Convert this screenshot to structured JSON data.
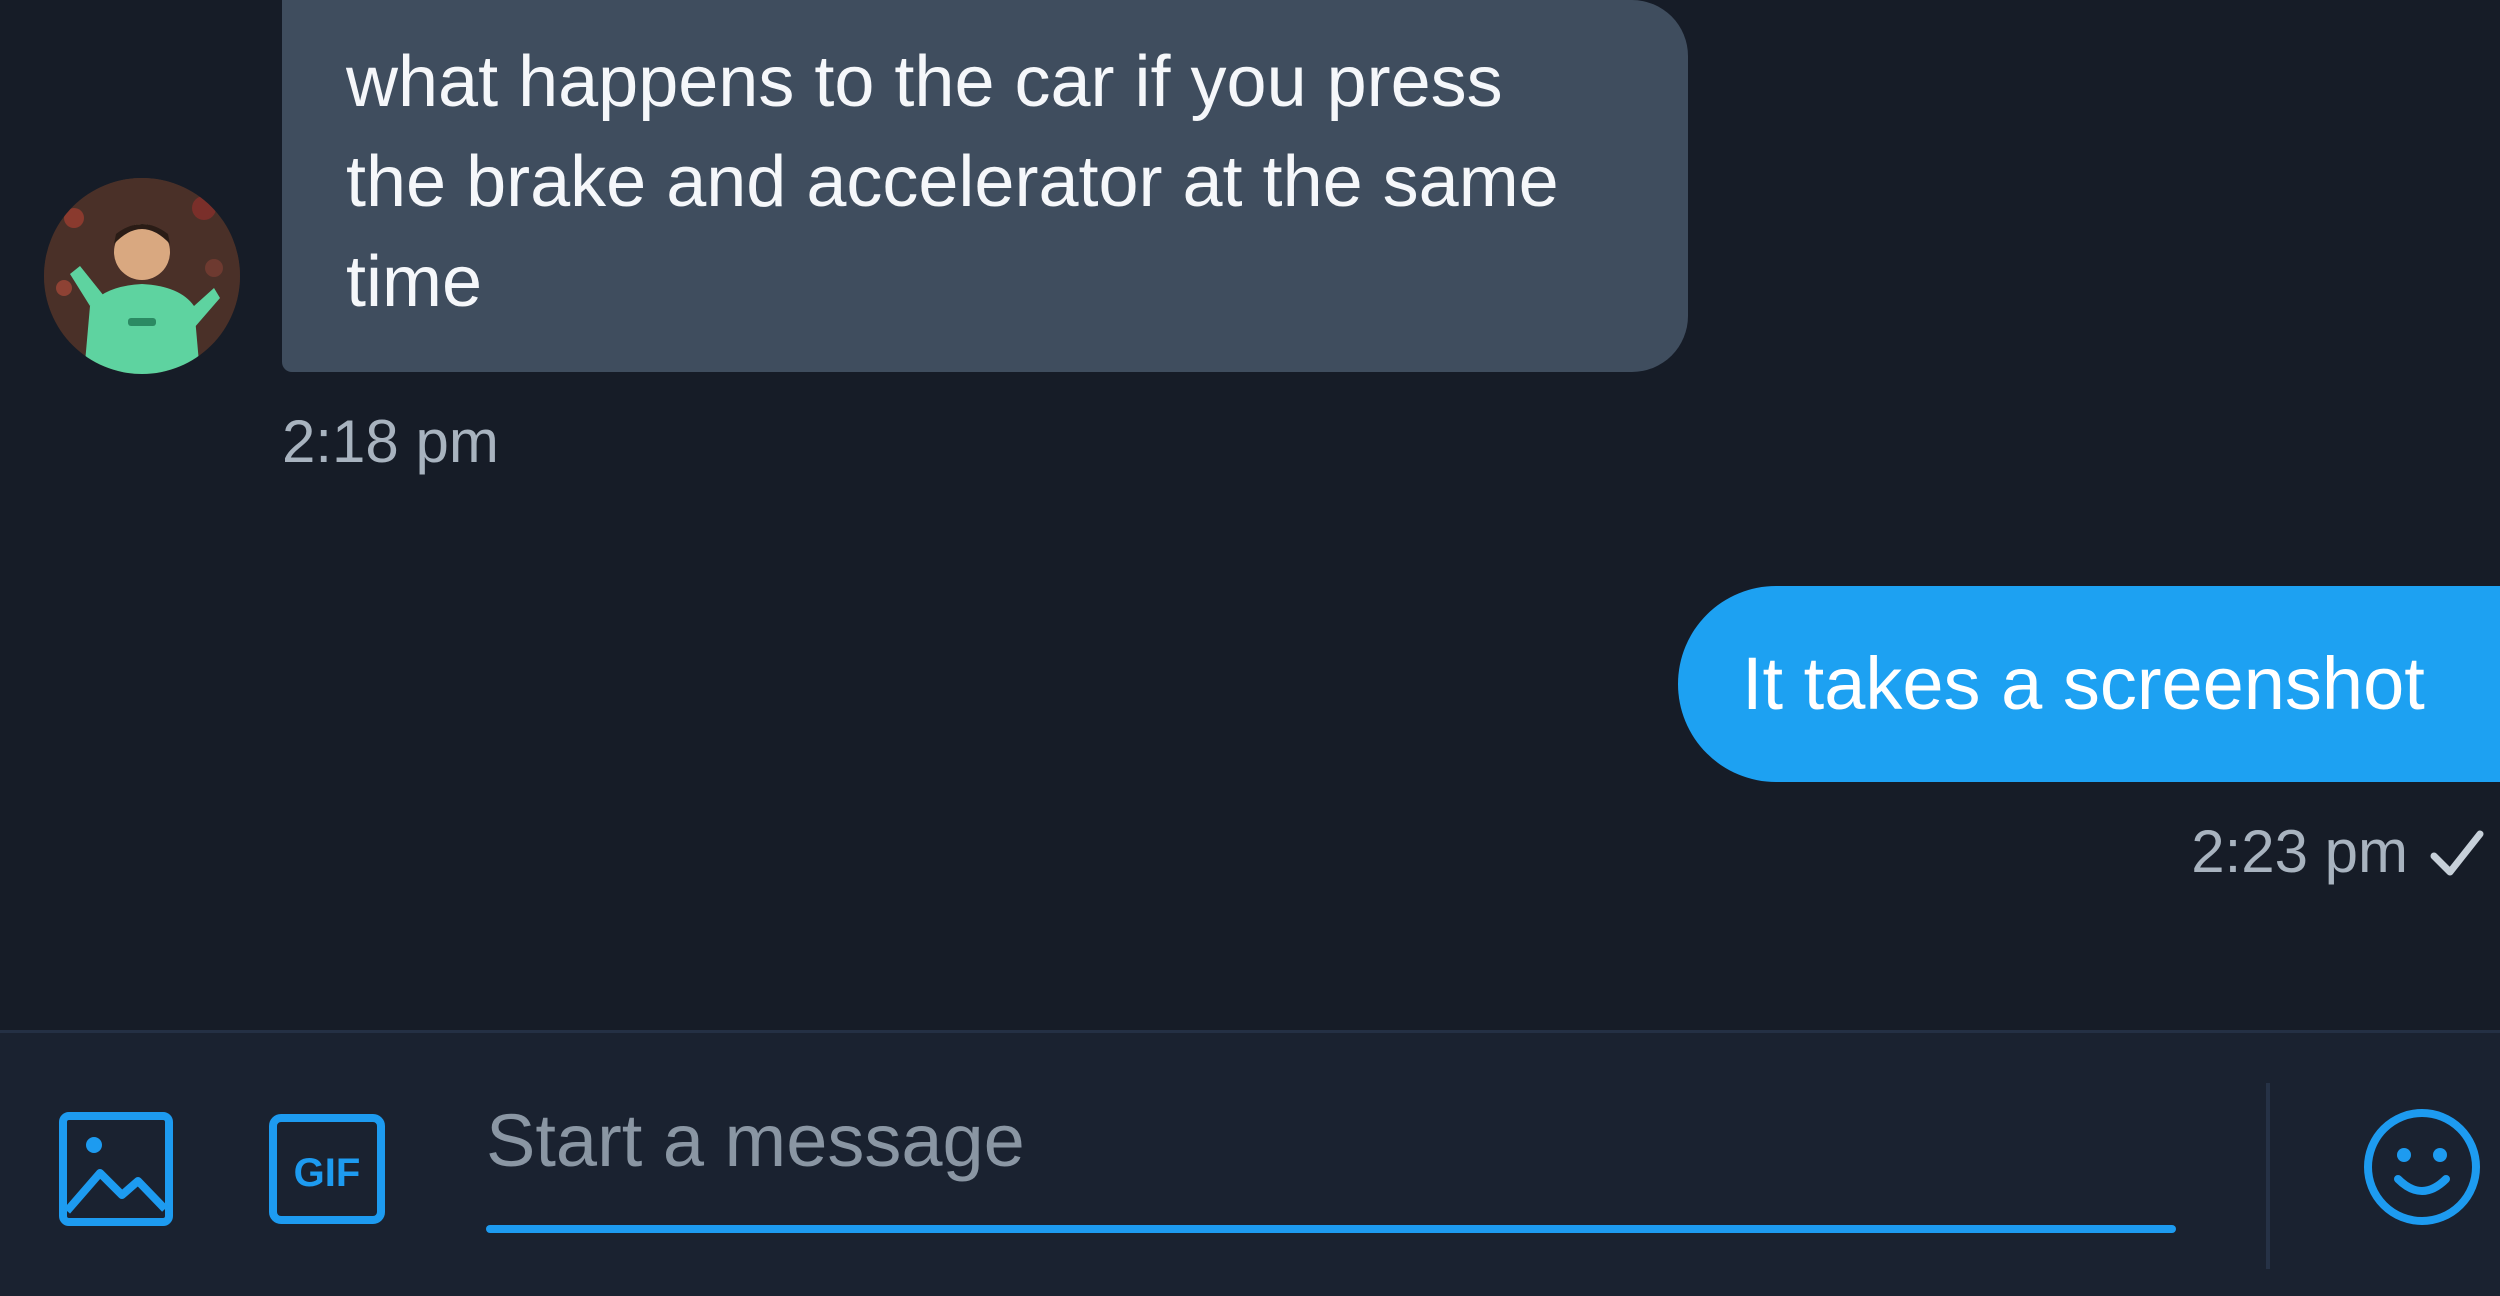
{
  "conversation": {
    "incoming": {
      "lines": [
        "what happens to the car if you press",
        "the brake and accelerator at the same",
        "time"
      ],
      "time": "2:18 pm"
    },
    "outgoing": {
      "text": "It takes a screenshot",
      "time": "2:23 pm",
      "status_icon": "check-icon"
    }
  },
  "composer": {
    "placeholder": "Start a message",
    "value": "",
    "gif_label": "GIF",
    "icons": [
      "image-icon",
      "gif-icon",
      "emoji-icon"
    ]
  },
  "colors": {
    "background": "#161c27",
    "incoming_bubble": "#3f4d5e",
    "outgoing_bubble": "#1da1f2",
    "accent": "#1d9bf0",
    "timestamp": "#a8b3bf"
  }
}
